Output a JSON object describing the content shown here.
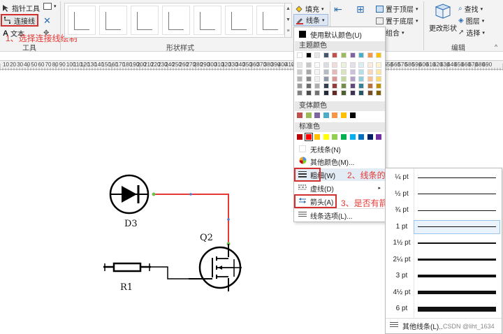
{
  "ribbon": {
    "tools": {
      "pointer_tool": "指针工具",
      "connector": "连接线",
      "text": "文本",
      "group_label": "工具"
    },
    "shape_styles_label": "形状样式",
    "fill": "填充",
    "line": "线条",
    "bring_front": "置于顶层",
    "send_back": "置于底层",
    "group": "组合",
    "change_shape": "更改形状",
    "find": "查找",
    "layers": "图层",
    "select": "选择",
    "edit_label": "编辑",
    "partial_label": "位置"
  },
  "annotations": {
    "a1": "1、选择连接线绘制",
    "a2": "2、线条的粗细设置",
    "a3": "3、是否有箭头设置"
  },
  "ruler": [
    "10",
    "20",
    "30",
    "40",
    "50",
    "60",
    "70",
    "80",
    "90",
    "100",
    "110",
    "120",
    "130",
    "140",
    "150",
    "160",
    "170",
    "180",
    "190",
    "200",
    "210",
    "220",
    "230",
    "240",
    "250",
    "260",
    "270",
    "280",
    "290",
    "300",
    "310",
    "320",
    "330",
    "340",
    "350",
    "360",
    "370",
    "380",
    "390",
    "400",
    "410",
    "420",
    "430",
    "440",
    "450",
    "460",
    "470",
    "480",
    "490",
    "500",
    "510",
    "520",
    "530",
    "540",
    "550",
    "560",
    "570",
    "580",
    "590",
    "600",
    "610",
    "620",
    "630",
    "640",
    "650",
    "660",
    "670",
    "680",
    "690",
    "700",
    "710"
  ],
  "canvas": {
    "d3": "D3",
    "q2": "Q2",
    "r1": "R1"
  },
  "dropdown": {
    "use_default": "使用默认颜色(U)",
    "theme_colors": "主题颜色",
    "variant_colors": "变体颜色",
    "standard_colors": "标准色",
    "no_line": "无线条(N)",
    "more_colors": "其他颜色(M)...",
    "weight": "粗细(W)",
    "dashes": "虚线(D)",
    "arrows": "箭头(A)",
    "line_options": "线条选项(L)..."
  },
  "colors": {
    "theme_top": [
      "#ffffff",
      "#000000",
      "#e7e6e6",
      "#44546a",
      "#c0504d",
      "#9bbb59",
      "#8064a2",
      "#4bacc6",
      "#f79646",
      "#ffc000"
    ],
    "variant": [
      "#c0504d",
      "#9bbb59",
      "#8064a2",
      "#4bacc6",
      "#f79646",
      "#ffc000",
      "#000000"
    ],
    "standard": [
      "#c00000",
      "#ff0000",
      "#ffc000",
      "#ffff00",
      "#92d050",
      "#00b050",
      "#00b0f0",
      "#0070c0",
      "#002060",
      "#7030a0"
    ],
    "accent": "#d32f2f",
    "wire_red": "#e53935"
  },
  "weights": {
    "items": [
      "¼ pt",
      "½ pt",
      "¾ pt",
      "1 pt",
      "1½ pt",
      "2¼ pt",
      "3 pt",
      "4½ pt",
      "6 pt"
    ],
    "selected_index": 3,
    "more": "其他线条(L)..."
  },
  "watermark": "CSDN @liht_1634"
}
